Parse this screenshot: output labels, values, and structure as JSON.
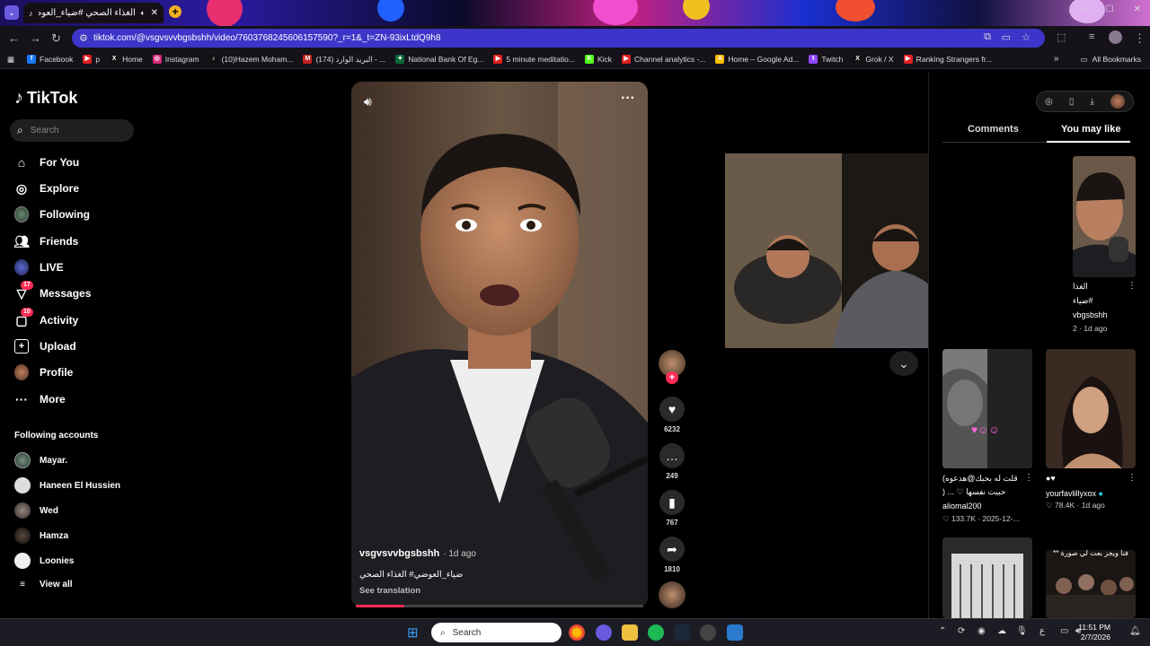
{
  "browser": {
    "tab_title": "الغذاء الصحي #ضياء_العوضي",
    "url": "tiktok.com/@vsgvsvvbgsbshh/video/7603768245606157590?_r=1&_t=ZN-93ixLtdQ9h8",
    "bookmarks": [
      {
        "label": "Facebook",
        "color": "#1877f2",
        "glyph": "f"
      },
      {
        "label": "p",
        "color": "#e02020",
        "glyph": "▶"
      },
      {
        "label": "Home",
        "color": "#111111",
        "glyph": "X"
      },
      {
        "label": "Instagram",
        "color": "#d62976",
        "glyph": "◎"
      },
      {
        "label": "(10)Hazem Moham...",
        "color": "#111111",
        "glyph": "♪"
      },
      {
        "label": "(174) البريد الوارد - ...",
        "color": "#c5221f",
        "glyph": "M"
      },
      {
        "label": "National Bank Of Eg...",
        "color": "#0a6b3a",
        "glyph": "✦"
      },
      {
        "label": "5 minute meditatio...",
        "color": "#e02020",
        "glyph": "▶"
      },
      {
        "label": "Kick",
        "color": "#53fc18",
        "glyph": "K"
      },
      {
        "label": "Channel analytics -...",
        "color": "#e02020",
        "glyph": "▶"
      },
      {
        "label": "Home – Google Ad...",
        "color": "#fbbc04",
        "glyph": "A"
      },
      {
        "label": "Twitch",
        "color": "#9146ff",
        "glyph": "t"
      },
      {
        "label": "Grok / X",
        "color": "#111111",
        "glyph": "X"
      },
      {
        "label": "Ranking Strangers fr...",
        "color": "#e02020",
        "glyph": "▶"
      }
    ],
    "all_bookmarks": "All Bookmarks"
  },
  "sidebar": {
    "logo": "TikTok",
    "search_placeholder": "Search",
    "nav": [
      {
        "label": "For You",
        "icon": "home-icon"
      },
      {
        "label": "Explore",
        "icon": "compass-icon"
      },
      {
        "label": "Following",
        "icon": "avatar"
      },
      {
        "label": "Friends",
        "icon": "friends-icon"
      },
      {
        "label": "LIVE",
        "icon": "live-avatar"
      },
      {
        "label": "Messages",
        "icon": "message-icon",
        "badge": "17"
      },
      {
        "label": "Activity",
        "icon": "activity-icon",
        "badge": "10"
      },
      {
        "label": "Upload",
        "icon": "upload-icon"
      },
      {
        "label": "Profile",
        "icon": "avatar"
      },
      {
        "label": "More",
        "icon": "more-icon"
      }
    ],
    "following_header": "Following accounts",
    "following": [
      "Mayar.",
      "Haneen El Hussien",
      "Wed",
      "Hamza",
      "Loonies"
    ],
    "view_all": "View all"
  },
  "video": {
    "username": "vsgvsvvbgsbshh",
    "age": "· 1d ago",
    "caption": "ضياء_العوضي# الغذاء الصحي",
    "see_translation": "See translation",
    "progress": 0.17,
    "likes": "6232",
    "comments": "249",
    "saves": "767",
    "shares": "1810"
  },
  "right_panel": {
    "tabs": [
      "Comments",
      "You may like"
    ],
    "cards": [
      {
        "caption1": "الغذا",
        "caption2": "ضياء#",
        "user": "vbgsbshh",
        "meta": "2 · 1d ago"
      },
      {
        "caption1": "قلت له بحبك@هدعوه)",
        "caption2": "حبيت نفسها ♡ ... (",
        "user": "aliomal200",
        "meta": "♡ 133.7K · 2025-12-..."
      },
      {
        "caption1": "",
        "caption2": "",
        "user": "yourfavlillyxox",
        "meta": "♡ 78.4K · 1d ago"
      },
      {
        "caption1": "",
        "caption2": "",
        "user": "",
        "meta": ""
      },
      {
        "caption1": "فنا ويجز بعت لي صورة **",
        "caption2": "",
        "user": "",
        "meta": ""
      }
    ]
  },
  "taskbar": {
    "search": "Search",
    "time": "11:51 PM",
    "date": "2/7/2026",
    "lang": "ع"
  }
}
